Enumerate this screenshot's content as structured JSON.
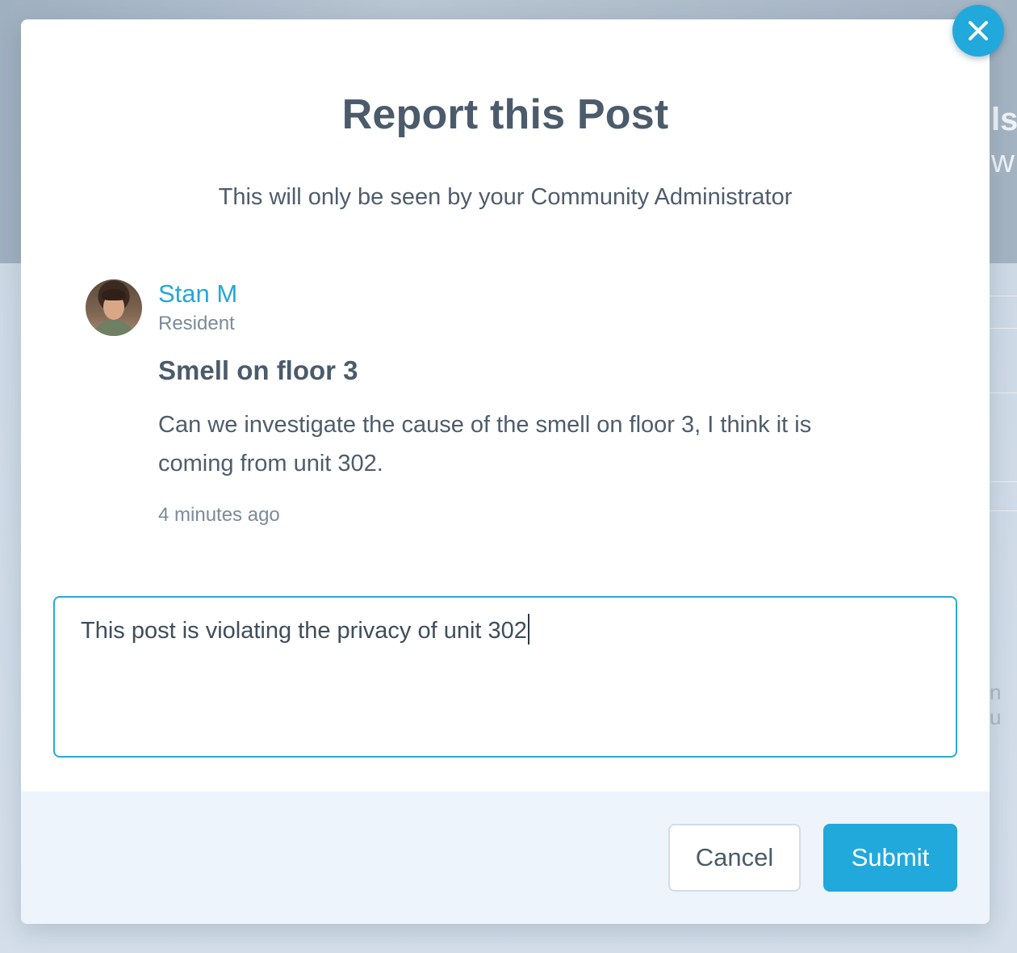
{
  "background": {
    "peek_text_top": "ls",
    "peek_text_second": "w",
    "peek_text_mid": "n u"
  },
  "modal": {
    "title": "Report this Post",
    "subtitle": "This will only be seen by your Community Administrator",
    "close_icon": "close-icon"
  },
  "post": {
    "author_name": "Stan M",
    "author_role": "Resident",
    "title": "Smell on floor 3",
    "body": "Can we investigate the cause of the smell on floor 3, I think it is coming from unit 302.",
    "time": "4 minutes ago"
  },
  "report": {
    "value": "This post is violating the privacy of unit 302"
  },
  "footer": {
    "cancel_label": "Cancel",
    "submit_label": "Submit"
  },
  "colors": {
    "accent": "#22a9dc",
    "title_text": "#4b5b6b",
    "footer_bg": "#edf4fb"
  }
}
